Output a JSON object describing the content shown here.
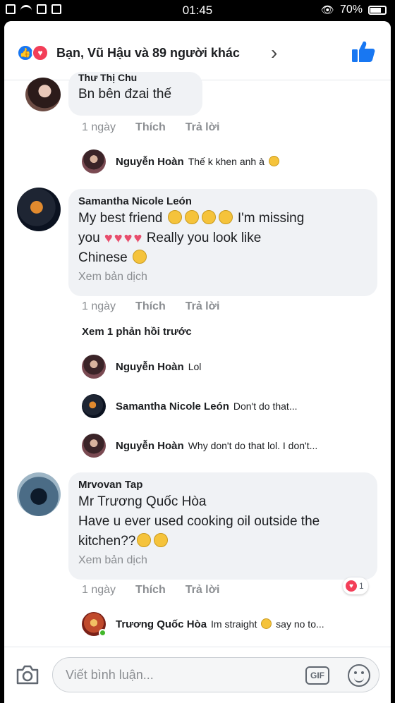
{
  "status_bar": {
    "time": "01:45",
    "battery": "70%"
  },
  "reactions": {
    "summary": "Bạn, Vũ Hậu và 89 người khác"
  },
  "comments": [
    {
      "author": "Thư Thị Chu",
      "text": "Bn bên đzai thế",
      "time": "1 ngày",
      "like_label": "Thích",
      "reply_label": "Trả lời",
      "replies": [
        {
          "name": "Nguyễn Hoàn",
          "text": "Thế k khen anh à"
        }
      ]
    },
    {
      "author": "Samantha Nicole León",
      "text_line1": "My best friend",
      "text_line1_end": "I'm missing",
      "text_line2_start": "you",
      "text_line2_end": "Really you look like",
      "text_line3": "Chinese",
      "translate": "Xem bản dịch",
      "time": "1 ngày",
      "like_label": "Thích",
      "reply_label": "Trả lời",
      "see_previous": "Xem 1 phản hồi trước",
      "replies": [
        {
          "name": "Nguyễn Hoàn",
          "text": "Lol"
        },
        {
          "name": "Samantha Nicole León",
          "text": "Don't do that..."
        },
        {
          "name": "Nguyễn Hoàn",
          "text": "Why don't do that lol. I don't..."
        }
      ]
    },
    {
      "author": "Mrvovan Tap",
      "text_line1": "Mr Trương Quốc Hòa",
      "text_line2": "Have u ever used cooking oil outside the",
      "text_line3": "kitchen??",
      "translate": "Xem bản dịch",
      "time": "1 ngày",
      "like_label": "Thích",
      "reply_label": "Trả lời",
      "reaction_count": "1",
      "replies": [
        {
          "name": "Trương Quốc Hòa",
          "text_start": "Im straight",
          "text_end": "say no to..."
        }
      ]
    }
  ],
  "composer": {
    "placeholder": "Viết bình luận...",
    "gif_label": "GIF"
  }
}
